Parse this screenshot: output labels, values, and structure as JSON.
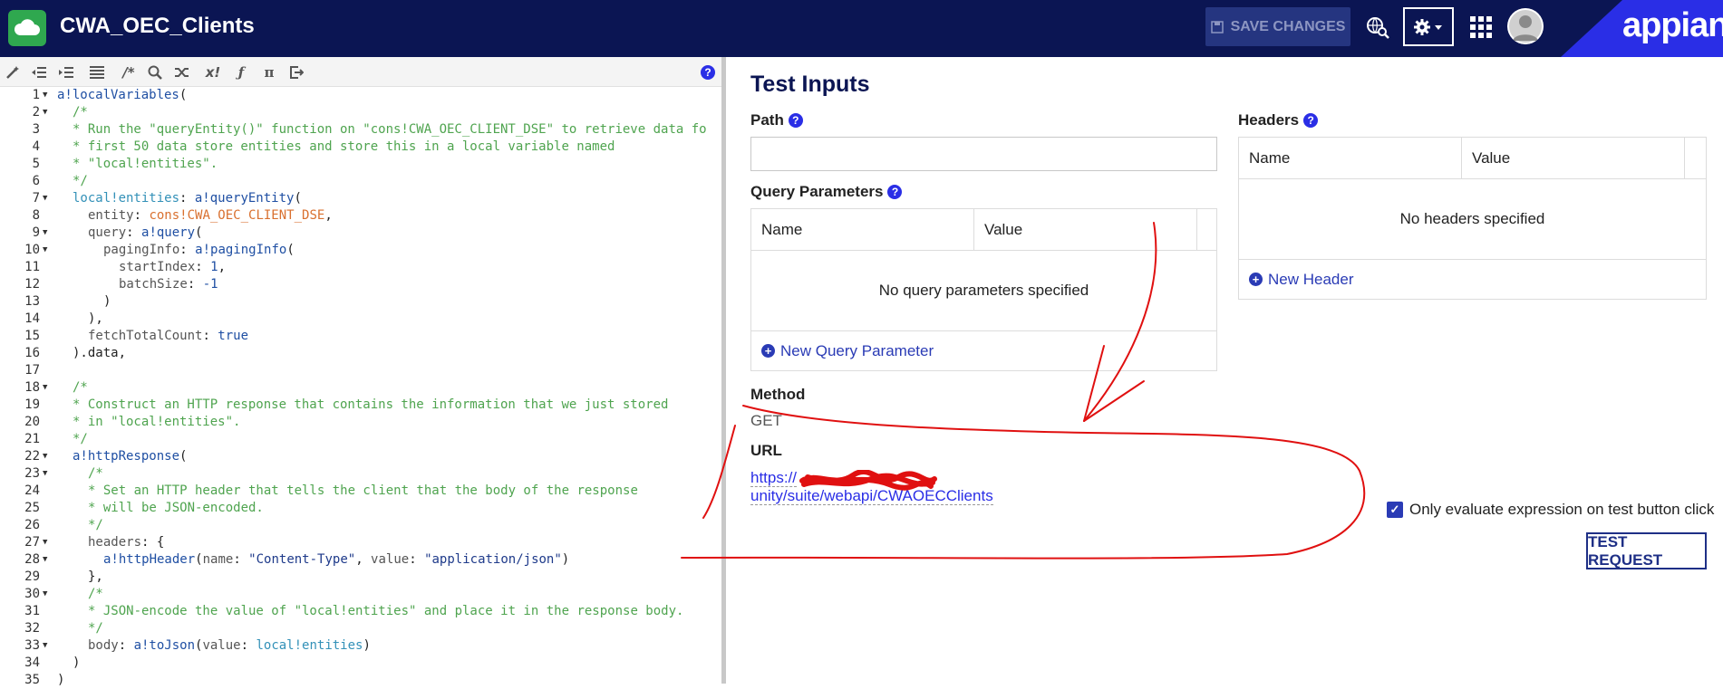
{
  "header": {
    "app_title": "CWA_OEC_Clients",
    "save_label": "SAVE CHANGES",
    "brand": "appian"
  },
  "editor": {
    "help": "?",
    "toolbar_icons": [
      "magic-wand-icon",
      "outdent-icon",
      "indent-icon",
      "list-icon",
      "comment-icon",
      "search-icon",
      "shuffle-icon",
      "x-bang-icon",
      "fx-icon",
      "pi-icon",
      "export-icon"
    ],
    "line_numbers": [
      "1",
      "2",
      "3",
      "4",
      "5",
      "6",
      "7",
      "8",
      "9",
      "10",
      "11",
      "12",
      "13",
      "14",
      "15",
      "16",
      "17",
      "18",
      "19",
      "20",
      "21",
      "22",
      "23",
      "24",
      "25",
      "26",
      "27",
      "28",
      "29",
      "30",
      "31",
      "32",
      "33",
      "34",
      "35"
    ]
  },
  "panel": {
    "title": "Test Inputs",
    "path_label": "Path",
    "query_label": "Query Parameters",
    "query_cols": [
      "Name",
      "Value"
    ],
    "query_empty": "No query parameters specified",
    "new_query": "New Query Parameter",
    "headers_label": "Headers",
    "header_cols": [
      "Name",
      "Value"
    ],
    "headers_empty": "No headers specified",
    "new_header": "New Header",
    "method_label": "Method",
    "method_value": "GET",
    "url_label": "URL",
    "url_prefix": "https://",
    "url_value": "unity/suite/webapi/CWAOECClients",
    "checkbox_label": "Only evaluate expression on test button click",
    "test_button": "TEST REQUEST"
  },
  "colors": {
    "header_bg": "#0b1553",
    "accent": "#2a2ee6",
    "annotation": "#e01010"
  }
}
